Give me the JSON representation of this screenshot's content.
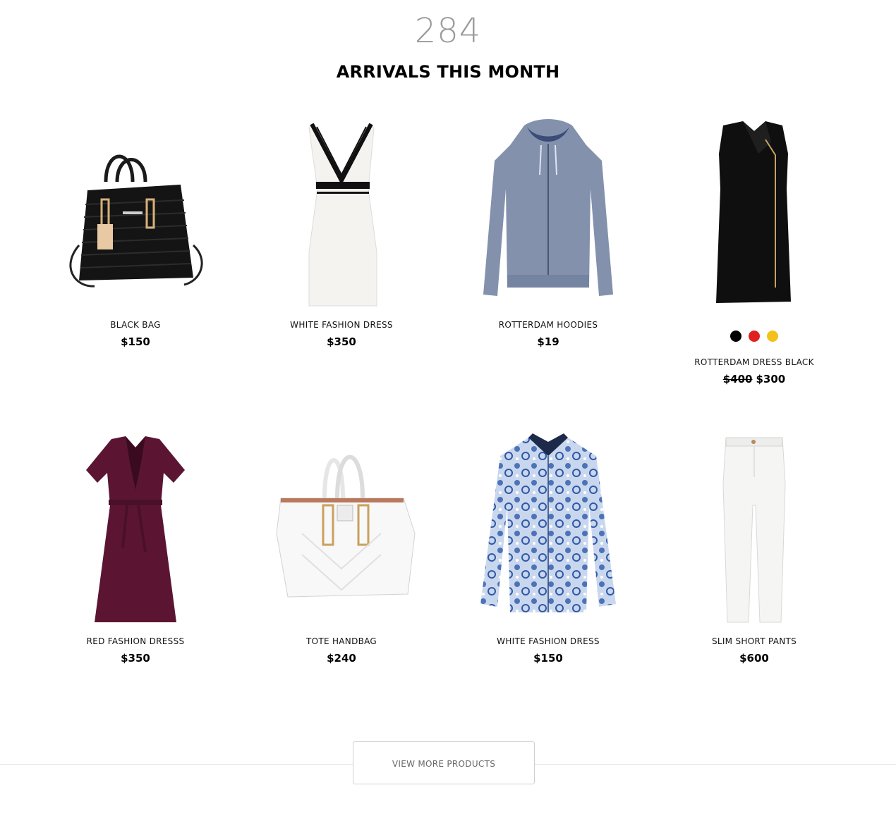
{
  "header": {
    "count": "284",
    "title": "ARRIVALS THIS MONTH"
  },
  "products": [
    {
      "name": "BLACK BAG",
      "price": "$150",
      "image": "black-bag-image"
    },
    {
      "name": "WHITE FASHION DRESS",
      "price": "$350",
      "image": "white-dress-image"
    },
    {
      "name": "ROTTERDAM HOODIES",
      "price": "$19",
      "image": "grey-hoodie-image"
    },
    {
      "name": "ROTTERDAM DRESS BLACK",
      "old_price": "$400",
      "price": "$300",
      "image": "black-dress-image",
      "swatches": [
        "#000000",
        "#e02020",
        "#f2c21b"
      ]
    },
    {
      "name": "RED FASHION DRESSS",
      "price": "$350",
      "image": "purple-dress-image"
    },
    {
      "name": "TOTE HANDBAG",
      "price": "$240",
      "image": "white-tote-image"
    },
    {
      "name": "WHITE FASHION DRESS",
      "price": "$150",
      "image": "paisley-shirt-image"
    },
    {
      "name": "SLIM SHORT PANTS",
      "price": "$600",
      "image": "white-jeans-image"
    }
  ],
  "footer": {
    "button_label": "VIEW MORE PRODUCTS"
  }
}
